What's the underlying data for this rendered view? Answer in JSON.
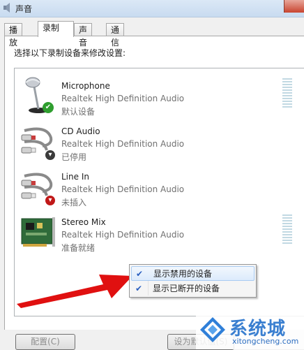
{
  "window": {
    "title": "声音"
  },
  "tabs": [
    {
      "label": "播放",
      "active": false
    },
    {
      "label": "录制",
      "active": true
    },
    {
      "label": "声音",
      "active": false
    },
    {
      "label": "通信",
      "active": false
    }
  ],
  "instruction": "选择以下录制设备来修改设置:",
  "devices": [
    {
      "name": "Microphone",
      "driver": "Realtek High Definition Audio",
      "status": "默认设备",
      "icon": "microphone-icon",
      "badge": "green-check-badge"
    },
    {
      "name": "CD Audio",
      "driver": "Realtek High Definition Audio",
      "status": "已停用",
      "icon": "rca-cable-icon",
      "badge": "disabled-arrow-badge"
    },
    {
      "name": "Line In",
      "driver": "Realtek High Definition Audio",
      "status": "未插入",
      "icon": "rca-cable-icon",
      "badge": "unplugged-arrow-badge"
    },
    {
      "name": "Stereo Mix",
      "driver": "Realtek High Definition Audio",
      "status": "准备就绪",
      "icon": "sound-card-icon",
      "badge": ""
    }
  ],
  "context_menu": {
    "items": [
      {
        "label": "显示禁用的设备",
        "checked": true
      },
      {
        "label": "显示已断开的设备",
        "checked": true
      }
    ]
  },
  "buttons": {
    "configure": "配置(C)",
    "set_default": "设为默认值(S)"
  },
  "watermark": {
    "text": "系统城",
    "url": "xitongcheng.com"
  },
  "colors": {
    "arrow": "#e01010",
    "check": "#2a5fbf",
    "badge_green": "#2f9e2f"
  }
}
